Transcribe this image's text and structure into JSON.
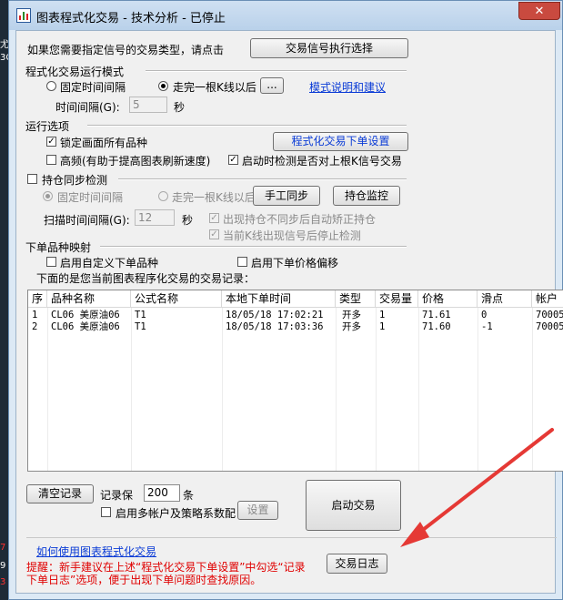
{
  "window": {
    "title": "图表程式化交易 - 技术分析 - 已停止",
    "close_glyph": "✕"
  },
  "signal": {
    "prompt": "如果您需要指定信号的交易类型，请点击",
    "button": "交易信号执行选择"
  },
  "mode": {
    "group_label": "程式化交易运行模式",
    "radio_fixed": "固定时间间隔",
    "radio_bar": "走完一根K线以后",
    "ellipsis_button": "...",
    "help_link": "模式说明和建议",
    "interval_label": "时间间隔(G):",
    "interval_value": "5",
    "interval_unit": "秒"
  },
  "options": {
    "group_label": "运行选项",
    "lock_label": "锁定画面所有品种",
    "order_settings_button": "程式化交易下单设置",
    "highfreq_label": "高频(有助于提高图表刷新速度)",
    "startup_check_label": "启动时检测是否对上根K信号交易"
  },
  "sync": {
    "group_label": "持仓同步检测",
    "radio_fixed": "固定时间间隔",
    "radio_bar": "走完一根K线以后",
    "manual_button": "手工同步",
    "monitor_button": "持仓监控",
    "scan_label": "扫描时间间隔(G):",
    "scan_value": "12",
    "scan_unit": "秒",
    "auto_correct_label": "出现持仓不同步后自动矫正持仓",
    "stop_check_label": "当前K线出现信号后停止检测"
  },
  "mapping": {
    "group_label": "下单品种映射",
    "custom_label": "启用自定义下单品种",
    "offset_label": "启用下单价格偏移"
  },
  "records": {
    "caption": "下面的是您当前图表程序化交易的交易记录：",
    "columns": [
      "序",
      "品种名称",
      "公式名称",
      "本地下单时间",
      "类型",
      "交易量",
      "价格",
      "滑点",
      "帐户"
    ],
    "rows": [
      [
        "1",
        "CL06 美原油06",
        "T1",
        "18/05/18 17:02:21",
        "开多",
        "1",
        "71.61",
        "0",
        "70005"
      ],
      [
        "2",
        "CL06 美原油06",
        "T1",
        "18/05/18 17:03:36",
        "开多",
        "1",
        "71.60",
        "-1",
        "70005"
      ]
    ]
  },
  "bottom": {
    "clear_button": "清空记录",
    "keep_label": "记录保",
    "keep_value": "200",
    "keep_unit": "条",
    "multi_account_label": "启用多帐户及策略系数配",
    "settings_button": "设置",
    "start_button": "启动交易",
    "howto_link": "如何使用图表程式化交易",
    "hint_line1": "提醒：新手建议在上述“程式化交易下单设置”中勾选“记录",
    "hint_line2": "下单日志”选项，便于出现下单问题时查找原因。",
    "log_button": "交易日志"
  },
  "background_marks": [
    "尤",
    "3C",
    "7",
    "9",
    "3"
  ],
  "colors": {
    "accent_link": "#0a3bd6",
    "hint_red": "#e00000",
    "arrow_red": "#e53935"
  }
}
